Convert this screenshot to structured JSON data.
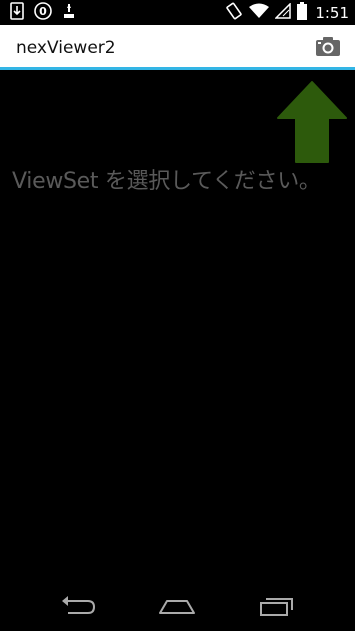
{
  "status_bar": {
    "time": "1:51",
    "left_icons": [
      "download-icon",
      "notification-count-icon",
      "usb-icon"
    ],
    "notification_count": "0",
    "right_icons": [
      "rotation-icon",
      "wifi-icon",
      "signal-icon",
      "battery-icon"
    ]
  },
  "action_bar": {
    "title": "nexViewer2",
    "camera_icon": "camera-icon",
    "accent_color": "#33b5e5"
  },
  "main": {
    "hint_text": "ViewSet を選択してください。",
    "hint_arrow_color": "#2d5a0c"
  },
  "nav_bar": {
    "icons": [
      "back-icon",
      "home-icon",
      "recent-apps-icon"
    ]
  }
}
